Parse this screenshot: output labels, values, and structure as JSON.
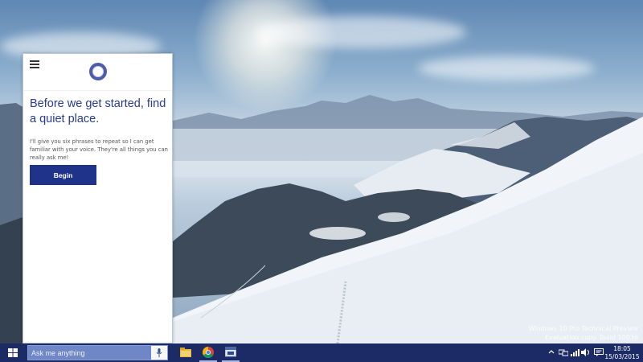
{
  "cortana": {
    "heading": "Before we get started, find a quiet place.",
    "body": "I'll give you six phrases to repeat so I can get familiar with your voice. They're all things you can really ask me!",
    "begin_label": "Begin"
  },
  "taskbar": {
    "search_placeholder": "Ask me anything",
    "clock_time": "18:05",
    "clock_date": "15/03/2015"
  },
  "watermark": {
    "line1": "Windows 10 Pro Technical Preview",
    "line2": "Evaluation copy. Build 10036"
  },
  "icons": {
    "start": "windows-logo-icon",
    "mic": "microphone-icon",
    "explorer": "file-explorer-icon",
    "chrome": "chrome-icon",
    "app": "app-window-icon",
    "tray": [
      "chevron-up-icon",
      "network-icon",
      "wifi-icon",
      "volume-icon",
      "notifications-icon"
    ]
  },
  "colors": {
    "taskbar": "#1c2a66",
    "search_box": "#6f86c7",
    "accent": "#1f3389",
    "heading": "#283b8f"
  }
}
